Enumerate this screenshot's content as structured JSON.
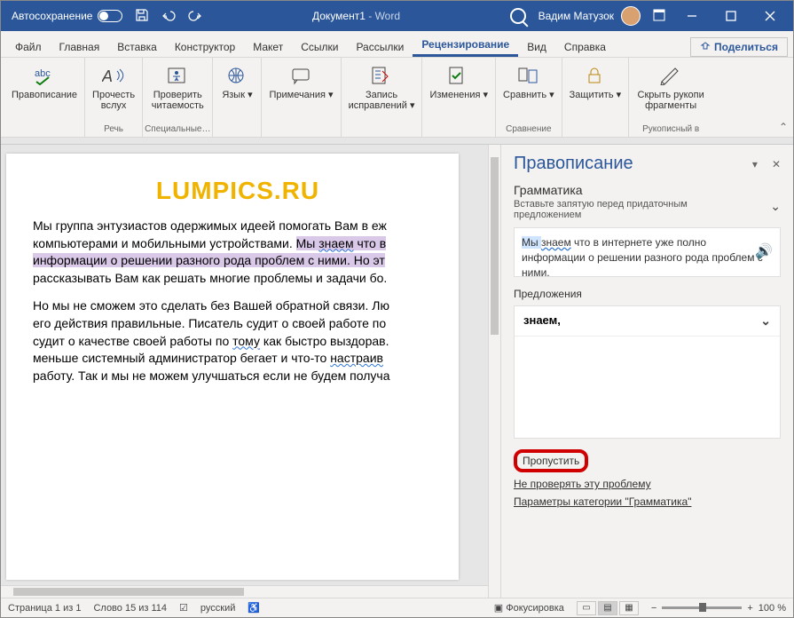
{
  "titlebar": {
    "autosave": "Автосохранение",
    "docname": "Документ1",
    "appname": " - Word",
    "user": "Вадим Матузок"
  },
  "tabs": {
    "file": "Файл",
    "home": "Главная",
    "insert": "Вставка",
    "design": "Конструктор",
    "layout": "Макет",
    "references": "Ссылки",
    "mailings": "Рассылки",
    "review": "Рецензирование",
    "view": "Вид",
    "help": "Справка",
    "share": "Поделиться"
  },
  "ribbon": {
    "spelling": "Правописание",
    "readaloud": "Прочесть\nвслух",
    "speech": "Речь",
    "accessibility": "Проверить\nчитаемость",
    "accgroup": "Специальные…",
    "language": "Язык",
    "comments": "Примечания",
    "tracking": "Запись\nисправлений",
    "changes": "Изменения",
    "compare": "Сравнить",
    "comparegrp": "Сравнение",
    "protect": "Защитить",
    "ink": "Скрыть рукопи\nфрагменты",
    "inkgrp": "Рукописный в"
  },
  "doc": {
    "logo": "LUMPICS.RU",
    "p1a": "Мы группа энтузиастов одержимых идеей помогать Вам в еж",
    "p1b": "компьютерами и мобильными устройствами. ",
    "p1c": "Мы ",
    "p1d": "знаем",
    "p1e": " что в",
    "p1f": "информации о решении разного рода проблем с ними. Но эт",
    "p1g": "рассказывать Вам как решать многие проблемы и задачи бо.",
    "p2a": "Но мы не сможем это сделать без Вашей обратной связи. Лю",
    "p2b": "его действия правильные. Писатель судит о своей работе по",
    "p2c": "судит о качестве своей работы по ",
    "p2d": "тому",
    "p2e": " как быстро выздорав.",
    "p2f": "меньше системный администратор бегает и что-то ",
    "p2g": "настраив",
    "p2h": "работу. Так и мы не можем улучшаться если не будем получа"
  },
  "panel": {
    "title": "Правописание",
    "subtitle": "Грамматика",
    "hint": "Вставьте запятую перед придаточным предложением",
    "context_a": "Мы ",
    "context_b": "знаем",
    "context_c": " что в интернете уже полно информации о решении разного рода проблем с ними.",
    "sugg_label": "Предложения",
    "sugg1": "знаем,",
    "skip": "Пропустить",
    "dont_check": "Не проверять эту проблему",
    "options": "Параметры категории \"Грамматика\""
  },
  "status": {
    "page": "Страница 1 из 1",
    "words": "Слово 15 из 114",
    "lang": "русский",
    "focus": "Фокусировка",
    "zoom": "100 %"
  }
}
